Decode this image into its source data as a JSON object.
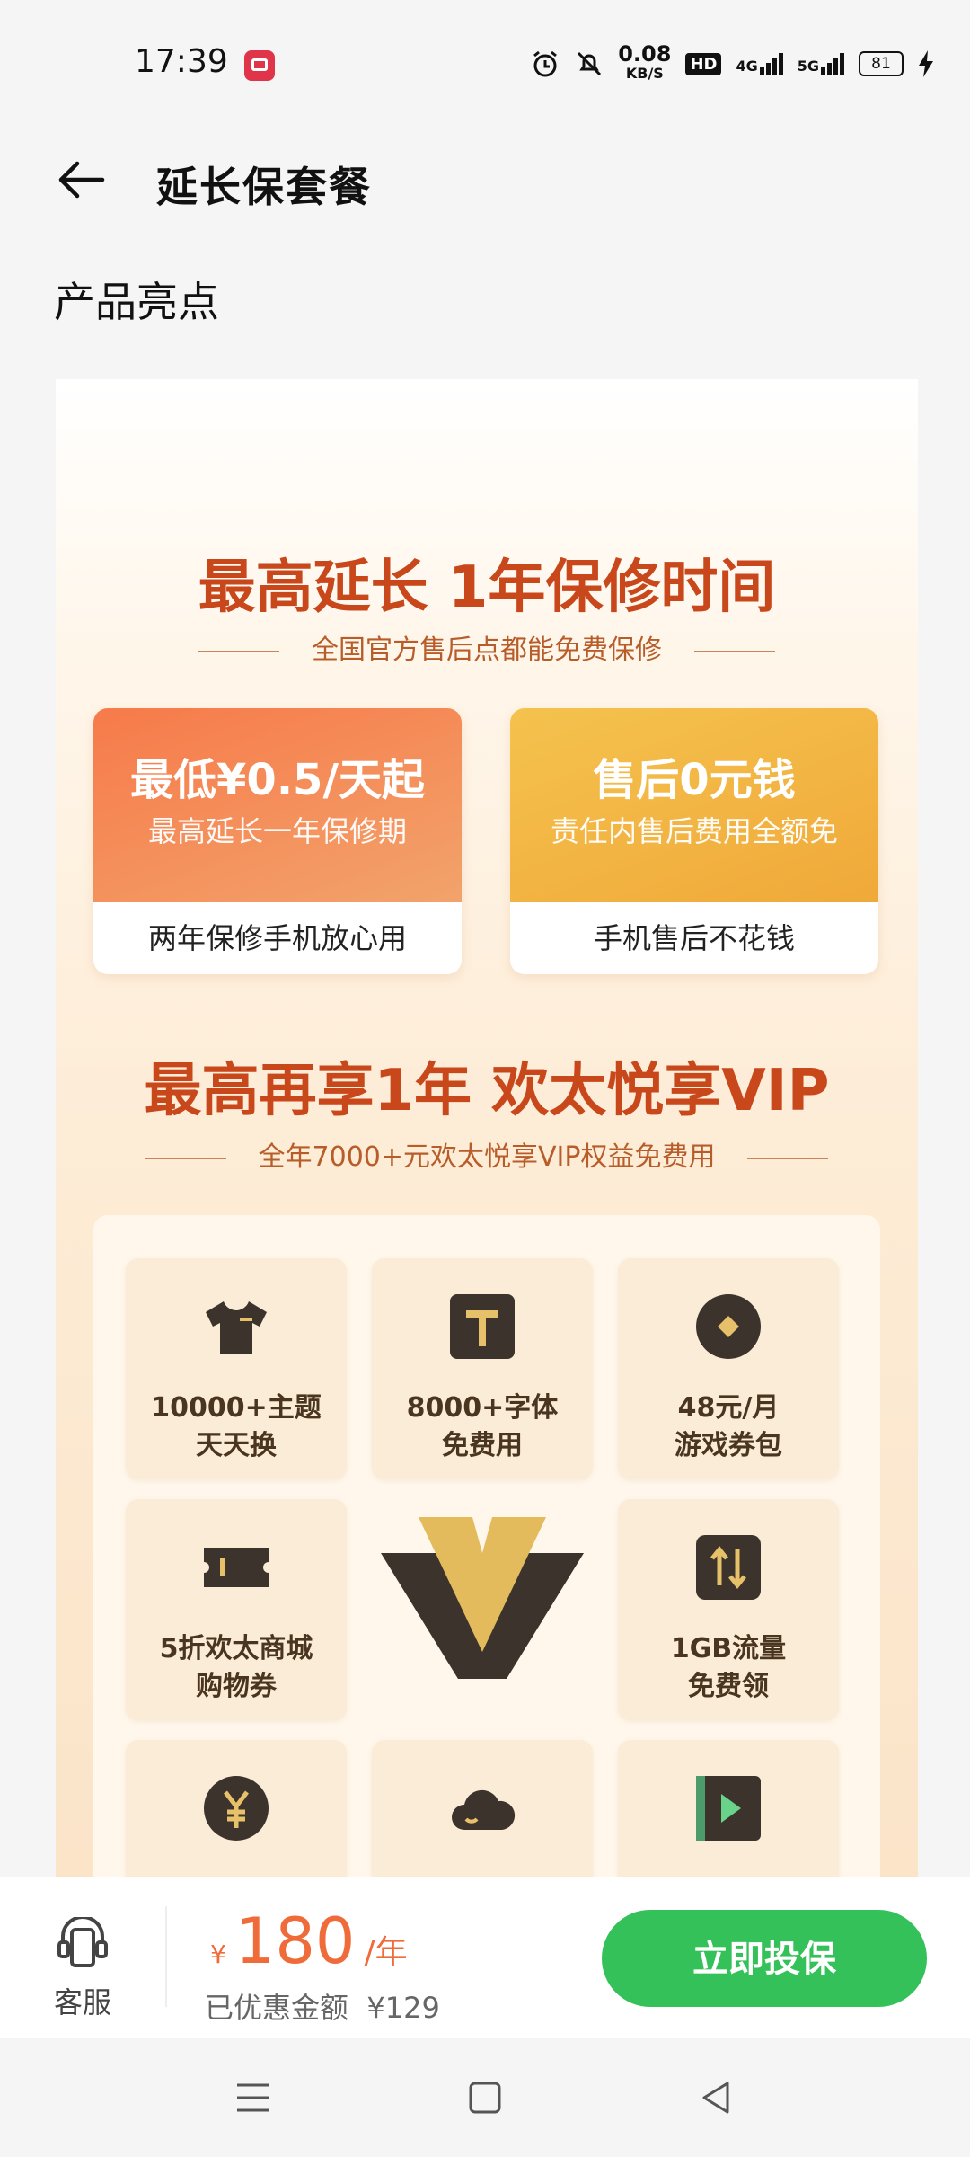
{
  "status": {
    "time": "17:39",
    "net_speed": "0.08",
    "net_unit": "KB/S",
    "hd": "HD",
    "sim1": "4G",
    "sim2": "5G",
    "battery": "81"
  },
  "appbar": {
    "title": "延长保套餐"
  },
  "section_title": "产品亮点",
  "promo": {
    "headline1": "最高延长 1年保修时间",
    "sub1": "全国官方售后点都能免费保修",
    "cards": [
      {
        "title": "最低¥0.5/天起",
        "subtitle": "最高延长一年保修期",
        "footer": "两年保修手机放心用"
      },
      {
        "title": "售后0元钱",
        "subtitle": "责任内售后费用全额免",
        "footer": "手机售后不花钱"
      }
    ],
    "headline2": "最高再享1年 欢太悦享VIP",
    "sub2": "全年7000+元欢太悦享VIP权益免费用",
    "tiles": [
      {
        "icon": "tshirt-icon",
        "line1": "10000+主题",
        "line2": "天天换"
      },
      {
        "icon": "font-icon",
        "line1": "8000+字体",
        "line2": "免费用"
      },
      {
        "icon": "game-coin-icon",
        "line1": "48元/月",
        "line2": "游戏券包"
      },
      {
        "icon": "ticket-icon",
        "line1": "5折欢太商城",
        "line2": "购物券"
      },
      {
        "icon": "data-transfer-icon",
        "line1": "1GB流量",
        "line2": "免费领"
      },
      {
        "icon": "yuan-coin-icon"
      },
      {
        "icon": "cloud-icon"
      },
      {
        "icon": "video-play-icon"
      }
    ]
  },
  "bottom": {
    "service_label": "客服",
    "currency": "¥",
    "price": "180",
    "unit": "/年",
    "discount_label": "已优惠金额",
    "discount_value": "¥129",
    "buy_label": "立即投保"
  },
  "colors": {
    "accent": "#c8481c",
    "buy_green": "#35c15a",
    "price_orange": "#f06b3a"
  }
}
